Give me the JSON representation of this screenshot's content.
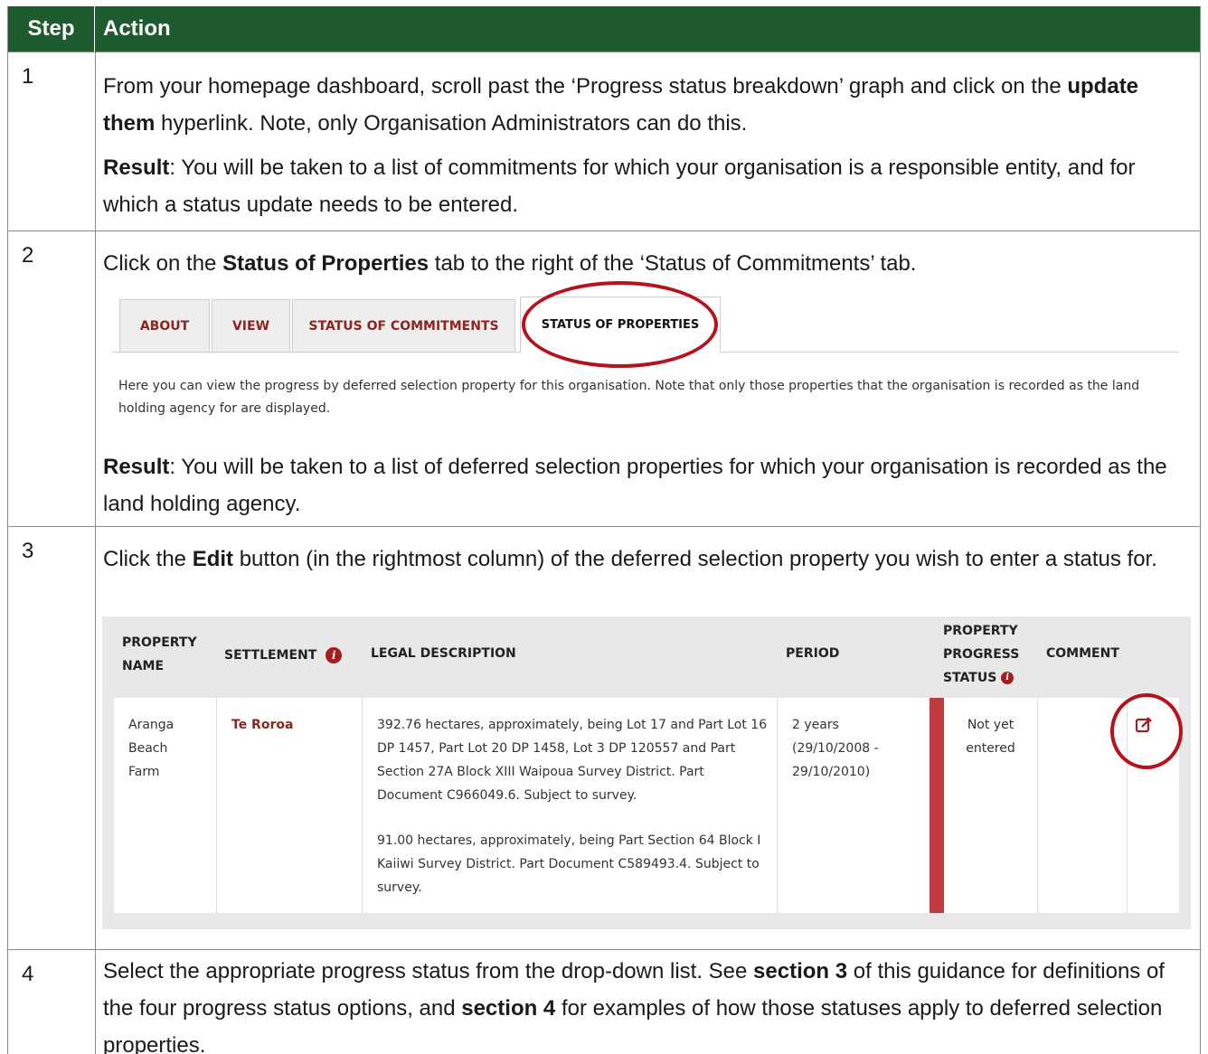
{
  "header": {
    "step": "Step",
    "action": "Action"
  },
  "steps": [
    {
      "num": "1",
      "p1_a": "From your homepage dashboard, scroll past the ‘Progress status breakdown’ graph and click on the ",
      "p1_b": "update them",
      "p1_c": " hyperlink. Note, only Organisation Administrators can do this.",
      "p2_a": "Result",
      "p2_b": ": You will be taken to a list of commitments for which your organisation is a responsible entity, and for which a status update needs to be entered."
    },
    {
      "num": "2",
      "p1_a": "Click on the ",
      "p1_b": "Status of Properties",
      "p1_c": " tab to the right of the ‘Status of Commitments’ tab.",
      "p2_a": "Result",
      "p2_b": ": You will be taken to a list of deferred selection properties for which your organisation is recorded as the land holding agency."
    },
    {
      "num": "3",
      "p1_a": "Click the ",
      "p1_b": "Edit",
      "p1_c": " button (in the rightmost column) of the deferred selection property you wish to enter a status for."
    },
    {
      "num": "4",
      "p1_a": "Select the appropriate progress status from the drop-down list. See ",
      "p1_b": "section 3",
      "p1_c": " of this guidance for definitions of the four progress status options, and ",
      "p1_d": "section 4",
      "p1_e": " for examples of how those statuses apply to deferred selection properties."
    }
  ],
  "tabs": {
    "items": [
      "ABOUT",
      "VIEW",
      "STATUS OF COMMITMENTS",
      "STATUS OF PROPERTIES"
    ],
    "note": "Here you can view the progress by deferred selection property for this organisation. Note that only those properties that the organisation is recorded as the land holding agency for are displayed."
  },
  "table": {
    "headers": {
      "property_name_1": "PROPERTY",
      "property_name_2": "NAME",
      "settlement": "SETTLEMENT",
      "legal": "LEGAL DESCRIPTION",
      "period": "PERIOD",
      "status_1": "PROPERTY",
      "status_2": "PROGRESS",
      "status_3": "STATUS",
      "comment": "COMMENT"
    },
    "row": {
      "name_1": "Aranga",
      "name_2": "Beach",
      "name_3": "Farm",
      "settlement": "Te Roroa",
      "legal_1": "392.76 hectares, approximately, being Lot 17 and Part Lot 16 DP 1457, Part Lot 20 DP 1458, Lot 3 DP 120557 and Part Section 27A Block XIII Waipoua Survey District. Part Document C966049.6. Subject to survey.",
      "legal_2": "91.00 hectares, approximately, being Part Section 64 Block I Kaiiwi Survey District. Part Document C589493.4. Subject to survey.",
      "period_1": "2 years",
      "period_2": "(29/10/2008 -",
      "period_3": "29/10/2010)",
      "status_1": "Not yet",
      "status_2": "entered"
    }
  },
  "colors": {
    "header_green": "#1e5b2e",
    "accent_red": "#b5121b",
    "status_red": "#c0393e"
  }
}
